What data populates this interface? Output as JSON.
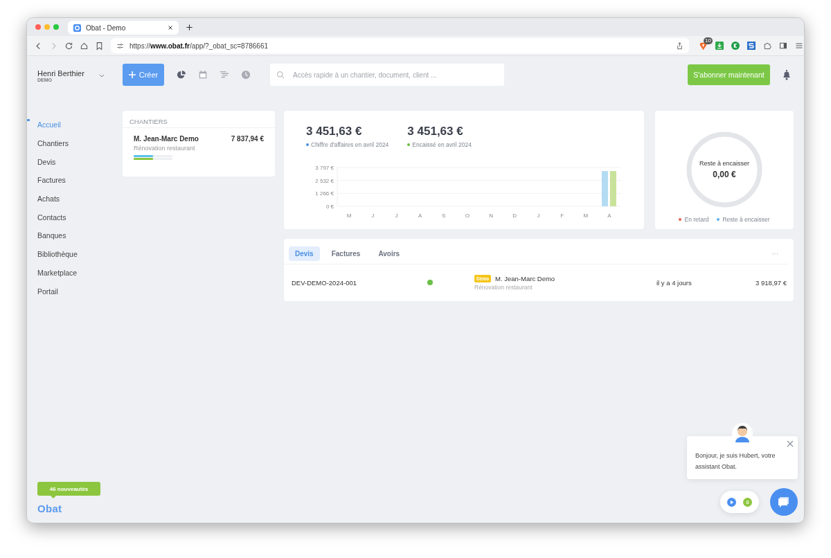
{
  "browser": {
    "tab_title": "Obat - Demo",
    "url_scheme": "https://",
    "url_host": "www.obat.fr",
    "url_path": "/app/?_obat_sc=8786661",
    "extension_badge": "10"
  },
  "user": {
    "name": "Henri Berthier",
    "org": "DEMO"
  },
  "create_button": {
    "label": "Créer"
  },
  "search": {
    "placeholder": "Accès rapide à un chantier, document, client ..."
  },
  "subscribe_button": {
    "label": "S'abonner maintenant"
  },
  "sidebar": {
    "items": [
      {
        "label": "Accueil",
        "selected": true
      },
      {
        "label": "Chantiers",
        "selected": false
      },
      {
        "label": "Devis",
        "selected": false
      },
      {
        "label": "Factures",
        "selected": false
      },
      {
        "label": "Achats",
        "selected": false
      },
      {
        "label": "Contacts",
        "selected": false
      },
      {
        "label": "Banques",
        "selected": false
      },
      {
        "label": "Bibliothèque",
        "selected": false
      },
      {
        "label": "Marketplace",
        "selected": false
      },
      {
        "label": "Portail",
        "selected": false
      }
    ],
    "news_badge": "46 nouveautés",
    "logo": "Obat"
  },
  "chantiers": {
    "title": "CHANTIERS",
    "items": [
      {
        "client": "M. Jean-Marc Demo",
        "project": "Rénovation restaurant",
        "amount": "7 837,94 €",
        "bars": [
          {
            "color": "#5bc0eb",
            "level": 0.5
          },
          {
            "color": "#8cc63f",
            "level": 0.5
          }
        ]
      }
    ]
  },
  "revenue": {
    "kpis": [
      {
        "value": "3 451,63 €",
        "label": "Chiffre d'affaires en avril 2024",
        "color": "#4a90e2"
      },
      {
        "value": "3 451,63 €",
        "label": "Encaissé en avril 2024",
        "color": "#6cbf3a"
      }
    ],
    "chart_data": {
      "type": "bar",
      "categories": [
        "M",
        "J",
        "J",
        "A",
        "S",
        "O",
        "N",
        "D",
        "J",
        "F",
        "M",
        "A"
      ],
      "series": [
        {
          "color": "#b3dcf2",
          "values": [
            0,
            0,
            0,
            0,
            0,
            0,
            0,
            0,
            0,
            0,
            0,
            3450
          ]
        },
        {
          "color": "#c8e29a",
          "values": [
            0,
            0,
            0,
            0,
            0,
            0,
            0,
            0,
            0,
            0,
            0,
            3450
          ]
        }
      ],
      "ylim": [
        0,
        3797
      ],
      "yticks": [
        {
          "value": 0,
          "label": "0 €"
        },
        {
          "value": 1266,
          "label": "1 266 €"
        },
        {
          "value": 2532,
          "label": "2 532 €"
        },
        {
          "value": 3797,
          "label": "3 797 €"
        }
      ]
    }
  },
  "outstanding": {
    "label": "Reste à encaisser",
    "value": "0,00 €",
    "legend": [
      {
        "label": "En retard",
        "color": "#e8604c"
      },
      {
        "label": "Reste à encaisser",
        "color": "#5bb0f0"
      }
    ]
  },
  "documents": {
    "tabs": [
      {
        "label": "Devis",
        "selected": true
      },
      {
        "label": "Factures",
        "selected": false
      },
      {
        "label": "Avoirs",
        "selected": false
      }
    ],
    "more": "···",
    "rows": [
      {
        "number": "DEV-DEMO-2024-001",
        "color": "#6cc04a",
        "tag": "Démo",
        "client": "M. Jean-Marc Demo",
        "project": "Rénovation restaurant",
        "date": "il y a 4 jours",
        "amount": "3 918,97 €"
      }
    ]
  },
  "chat": {
    "message": "Bonjour, je suis Hubert, votre assistant Obat.",
    "count": "8"
  }
}
